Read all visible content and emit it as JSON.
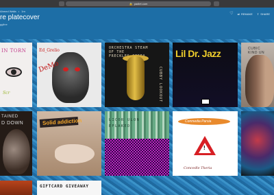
{
  "browser": {
    "url": "padlet.com"
  },
  "header": {
    "breadcrumb": [
      "Ahmed Walla",
      "1m"
    ],
    "title": "re platecover",
    "subtitle": "ggline",
    "actions": {
      "rename_label": "REMAKE",
      "share_label": "SHARE"
    }
  },
  "tiles": [
    {
      "label": "IN TORN",
      "extra": "Scr"
    },
    {
      "label": "Ed_Grelio",
      "extra": "DeMo"
    },
    {
      "label_lines": [
        "ORCHESTRA STEAM",
        "OF THE",
        "FRECKLES OPERA"
      ],
      "side": "CUBBY LOOKOUT"
    },
    {
      "label": "Lil Dr. Jazz"
    },
    {
      "label_lines": [
        "CUBIC",
        "KIND UN"
      ]
    },
    {
      "label_lines": [
        "TAINED",
        "D DOWN"
      ]
    },
    {
      "label": "Solid addiction"
    },
    {
      "label_lines": [
        "LICOR ULON",
        "EFLAKED"
      ]
    },
    {
      "label": "Conmedia Parsia",
      "signature": "Concedle Tkeria"
    },
    {
      "label": ""
    },
    {
      "label": ""
    },
    {
      "label": "GIFTCARD GIVEAWAY"
    }
  ]
}
